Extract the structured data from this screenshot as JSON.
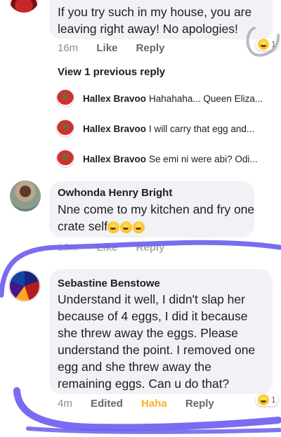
{
  "top_comment": {
    "text_line1": "If you try such in my house, you are",
    "text_line2": "leaving right away! No apologies!",
    "time": "16m",
    "like": "Like",
    "reply": "Reply",
    "reaction_icon": "laughing-emoji",
    "reaction_count": "1"
  },
  "view_previous": "View 1 previous reply",
  "replies": [
    {
      "name": "Hallex Bravoo",
      "text": "Hahahaha... Queen Eliza..."
    },
    {
      "name": "Hallex Bravoo",
      "text": "I will carry that egg and..."
    },
    {
      "name": "Hallex Bravoo",
      "text": "Se emi ni were abi? Odi..."
    }
  ],
  "owhonda": {
    "name": "Owhonda Henry Bright",
    "text_line1": "Nne  come to my kitchen and fry one",
    "text_line2": "crate self",
    "emojis": [
      "rofl-emoji",
      "rofl-emoji",
      "laughing-emoji"
    ],
    "time": "13m",
    "like": "Like",
    "reply": "Reply"
  },
  "sebastine": {
    "name": "Sebastine Benstowe",
    "lines": [
      "Understand it well, I didn't slap her",
      "because of 4 eggs, I did it because",
      "she threw away the eggs. Please",
      "understand the point. I removed one",
      "egg and she threw away the",
      "remaining eggs. Can u do that?"
    ],
    "time": "4m",
    "edited": "Edited",
    "haha": "Haha",
    "reply": "Reply",
    "reaction_icon": "laughing-emoji",
    "reaction_count": "1"
  },
  "colors": {
    "bubble": "#f0f2f5",
    "meta_text": "#65676b",
    "haha": "#f7b125",
    "annotation_stroke": "#6a5cf0"
  }
}
